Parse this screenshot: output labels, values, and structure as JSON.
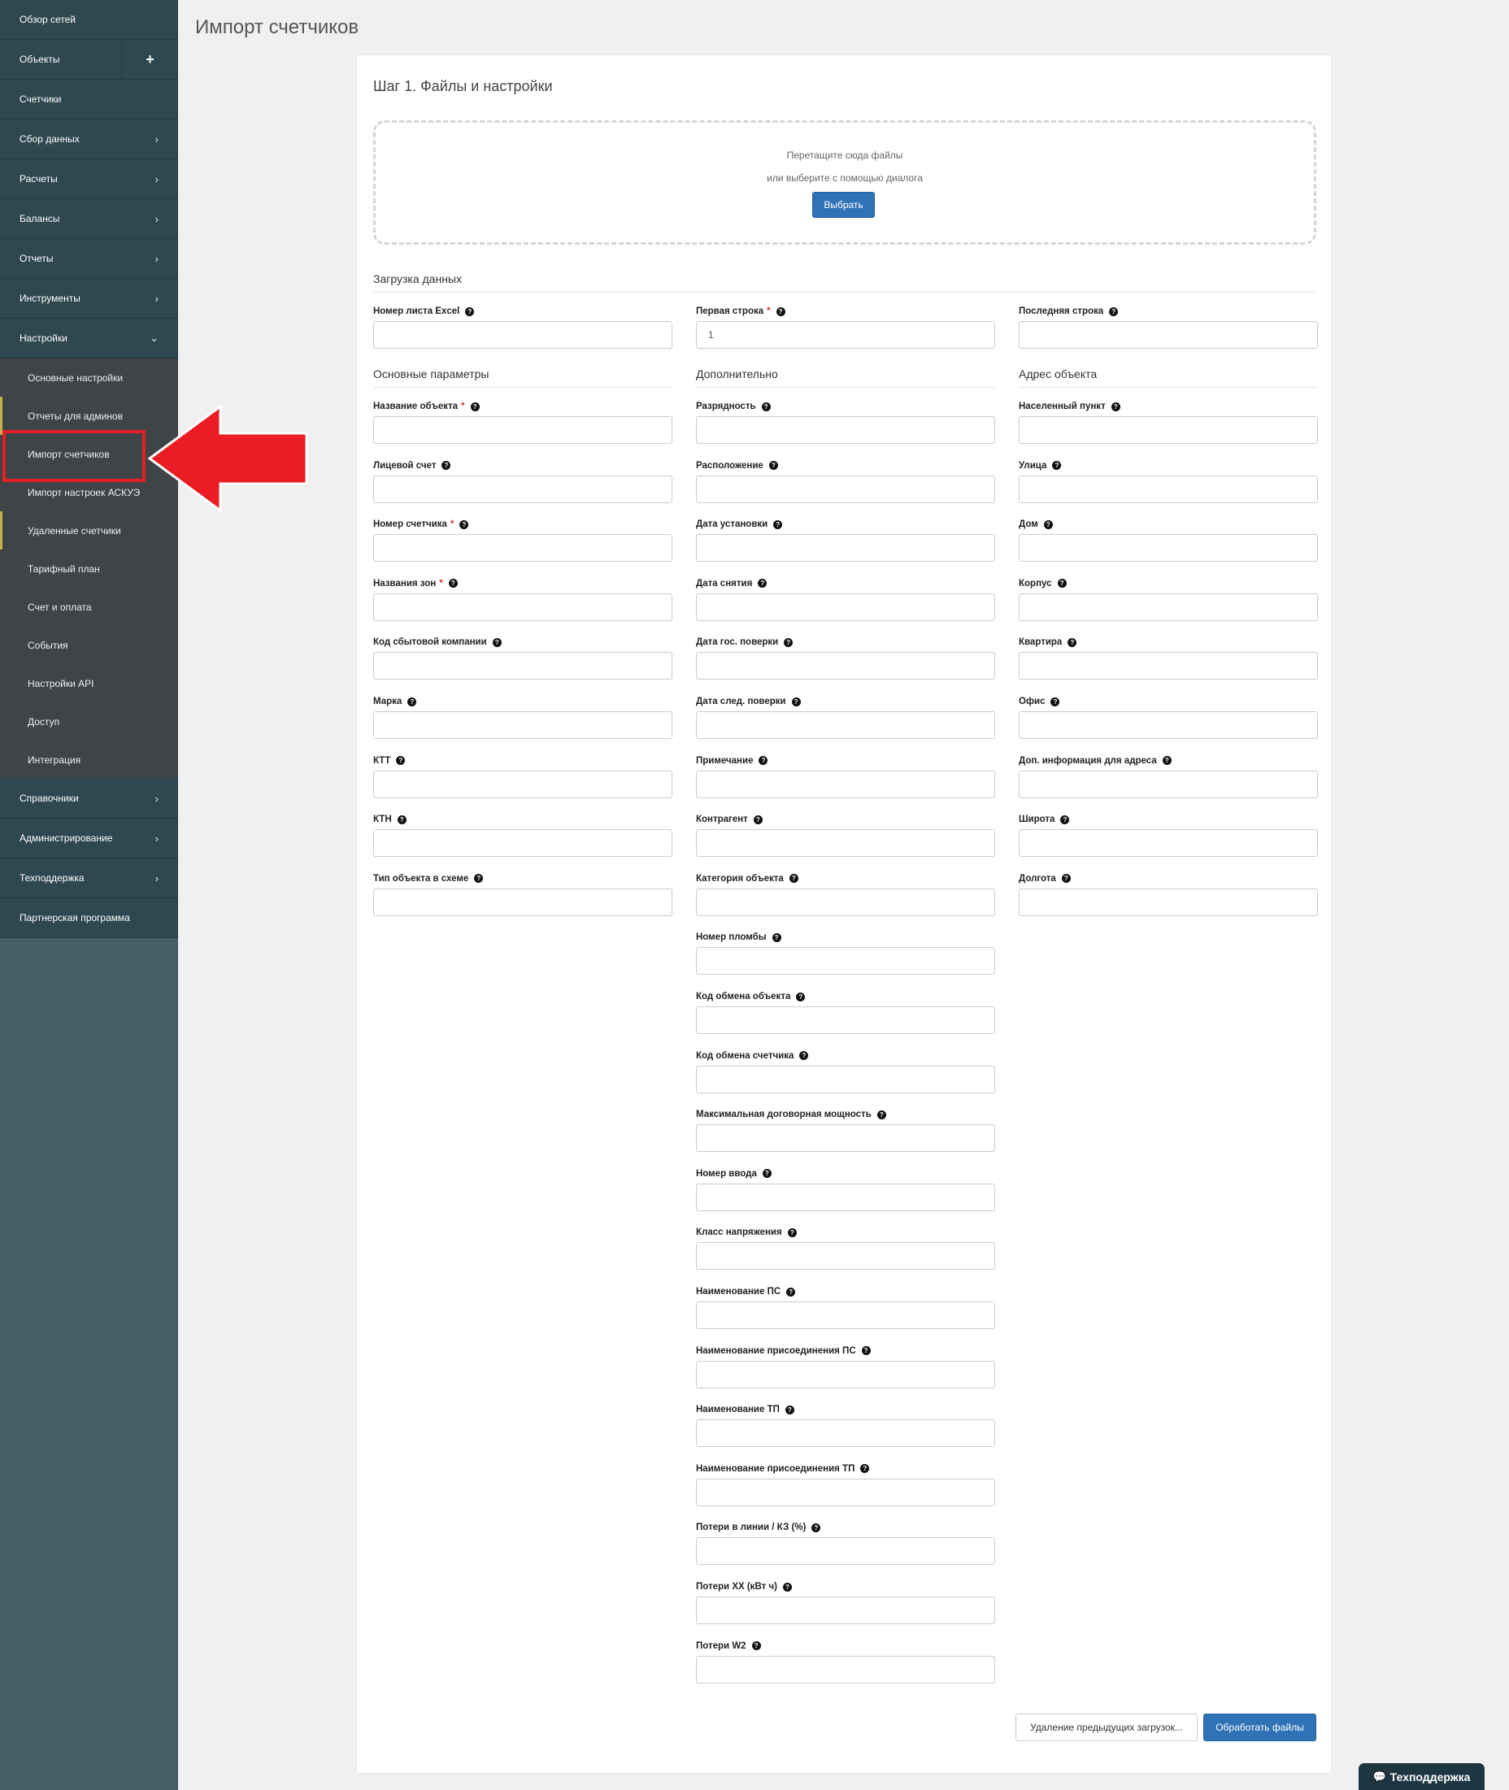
{
  "sidebar": {
    "items_top": [
      {
        "label": "Обзор сетей",
        "chevron": ""
      },
      {
        "label": "Объекты",
        "chevron": "+"
      },
      {
        "label": "Счетчики",
        "chevron": ""
      },
      {
        "label": "Сбор данных",
        "chevron": "›"
      },
      {
        "label": "Расчеты",
        "chevron": "›"
      },
      {
        "label": "Балансы",
        "chevron": "›"
      },
      {
        "label": "Отчеты",
        "chevron": "›"
      },
      {
        "label": "Инструменты",
        "chevron": "›"
      },
      {
        "label": "Настройки",
        "chevron": "⌄"
      }
    ],
    "submenu": [
      {
        "label": "Основные настройки"
      },
      {
        "label": "Отчеты для админов"
      },
      {
        "label": "Импорт счетчиков"
      },
      {
        "label": "Импорт настроек АСКУЭ"
      },
      {
        "label": "Удаленные счетчики"
      },
      {
        "label": "Тарифный план"
      },
      {
        "label": "Счет и оплата"
      },
      {
        "label": "События"
      },
      {
        "label": "Настройки API"
      },
      {
        "label": "Доступ"
      },
      {
        "label": "Интеграция"
      }
    ],
    "items_bottom": [
      {
        "label": "Справочники",
        "chevron": "›"
      },
      {
        "label": "Администрирование",
        "chevron": "›"
      },
      {
        "label": "Техподдержка",
        "chevron": "›"
      },
      {
        "label": "Партнерская программа",
        "chevron": ""
      }
    ],
    "highlight_color": "#e42026"
  },
  "page": {
    "title": "Импорт счетчиков",
    "step_title": "Шаг 1. Файлы и настройки",
    "dropzone": {
      "line1": "Перетащите сюда файлы",
      "line2": "или выберите с помощью диалога",
      "button": "Выбрать"
    },
    "sections": {
      "upload": "Загрузка данных",
      "main": "Основные параметры",
      "extra": "Дополнительно",
      "address": "Адрес объекта"
    },
    "upload_fields": [
      {
        "label": "Номер листа Excel",
        "required": false,
        "value": ""
      },
      {
        "label": "Первая строка",
        "required": true,
        "value": "1"
      },
      {
        "label": "Последняя строка",
        "required": false,
        "value": ""
      }
    ],
    "main_fields": [
      {
        "label": "Название объекта",
        "required": true
      },
      {
        "label": "Лицевой счет",
        "required": false
      },
      {
        "label": "Номер счетчика",
        "required": true
      },
      {
        "label": "Названия зон",
        "required": true
      },
      {
        "label": "Код сбытовой компании",
        "required": false
      },
      {
        "label": "Марка",
        "required": false
      },
      {
        "label": "КТТ",
        "required": false
      },
      {
        "label": "КТН",
        "required": false
      },
      {
        "label": "Тип объекта в схеме",
        "required": false
      }
    ],
    "extra_fields": [
      {
        "label": "Разрядность",
        "required": false
      },
      {
        "label": "Расположение",
        "required": false
      },
      {
        "label": "Дата установки",
        "required": false
      },
      {
        "label": "Дата снятия",
        "required": false
      },
      {
        "label": "Дата гос. поверки",
        "required": false
      },
      {
        "label": "Дата след. поверки",
        "required": false
      },
      {
        "label": "Примечание",
        "required": false
      },
      {
        "label": "Контрагент",
        "required": false
      },
      {
        "label": "Категория объекта",
        "required": false
      },
      {
        "label": "Номер пломбы",
        "required": false
      },
      {
        "label": "Код обмена объекта",
        "required": false
      },
      {
        "label": "Код обмена счетчика",
        "required": false
      },
      {
        "label": "Максимальная договорная мощность",
        "required": false
      },
      {
        "label": "Номер ввода",
        "required": false
      },
      {
        "label": "Класс напряжения",
        "required": false
      },
      {
        "label": "Наименование ПС",
        "required": false
      },
      {
        "label": "Наименование присоединения ПС",
        "required": false
      },
      {
        "label": "Наименование ТП",
        "required": false
      },
      {
        "label": "Наименование присоединения ТП",
        "required": false
      },
      {
        "label": "Потери в линии / КЗ (%)",
        "required": false
      },
      {
        "label": "Потери ХХ (кВт ч)",
        "required": false
      },
      {
        "label": "Потери W2",
        "required": false
      }
    ],
    "address_fields": [
      {
        "label": "Населенный пункт",
        "required": false
      },
      {
        "label": "Улица",
        "required": false
      },
      {
        "label": "Дом",
        "required": false
      },
      {
        "label": "Корпус",
        "required": false
      },
      {
        "label": "Квартира",
        "required": false
      },
      {
        "label": "Офис",
        "required": false
      },
      {
        "label": "Доп. информация для адреса",
        "required": false
      },
      {
        "label": "Широта",
        "required": false
      },
      {
        "label": "Долгота",
        "required": false
      }
    ],
    "buttons": {
      "clear": "Удаление предыдущих загрузок...",
      "process": "Обработать файлы"
    },
    "support": "Техподдержка"
  }
}
